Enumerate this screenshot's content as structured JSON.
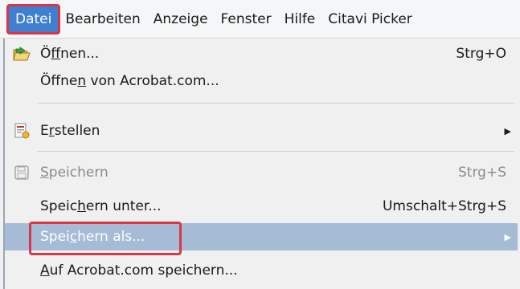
{
  "menubar": {
    "items": [
      {
        "label": "Datei",
        "active": true
      },
      {
        "label": "Bearbeiten"
      },
      {
        "label": "Anzeige"
      },
      {
        "label": "Fenster"
      },
      {
        "label": "Hilfe"
      },
      {
        "label": "Citavi Picker"
      }
    ]
  },
  "menu": {
    "open_label_pre": "Ö",
    "open_label_mnemonic": "f",
    "open_label_post": "fnen...",
    "open_shortcut": "Strg+O",
    "open_acrobat_pre": "Öffne",
    "open_acrobat_mnemonic": "n",
    "open_acrobat_post": " von Acrobat.com...",
    "create_pre": "E",
    "create_mnemonic": "r",
    "create_post": "stellen",
    "save_pre": "",
    "save_mnemonic": "S",
    "save_post": "peichern",
    "save_shortcut": "Strg+S",
    "save_under_pre": "Speic",
    "save_under_mnemonic": "h",
    "save_under_post": "ern unter...",
    "save_under_shortcut": "Umschalt+Strg+S",
    "save_as_pre": "Spei",
    "save_as_mnemonic": "c",
    "save_as_post": "hern als...",
    "acrobat_save_pre": "",
    "acrobat_save_mnemonic": "A",
    "acrobat_save_post": "uf Acrobat.com speichern..."
  },
  "icons": {
    "open": "folder-open-icon",
    "create": "create-pdf-icon",
    "save": "floppy-disk-icon"
  },
  "colors": {
    "highlight": "#a6bcd6",
    "active_menu": "#3f7fd0",
    "callout": "#dc3545"
  }
}
